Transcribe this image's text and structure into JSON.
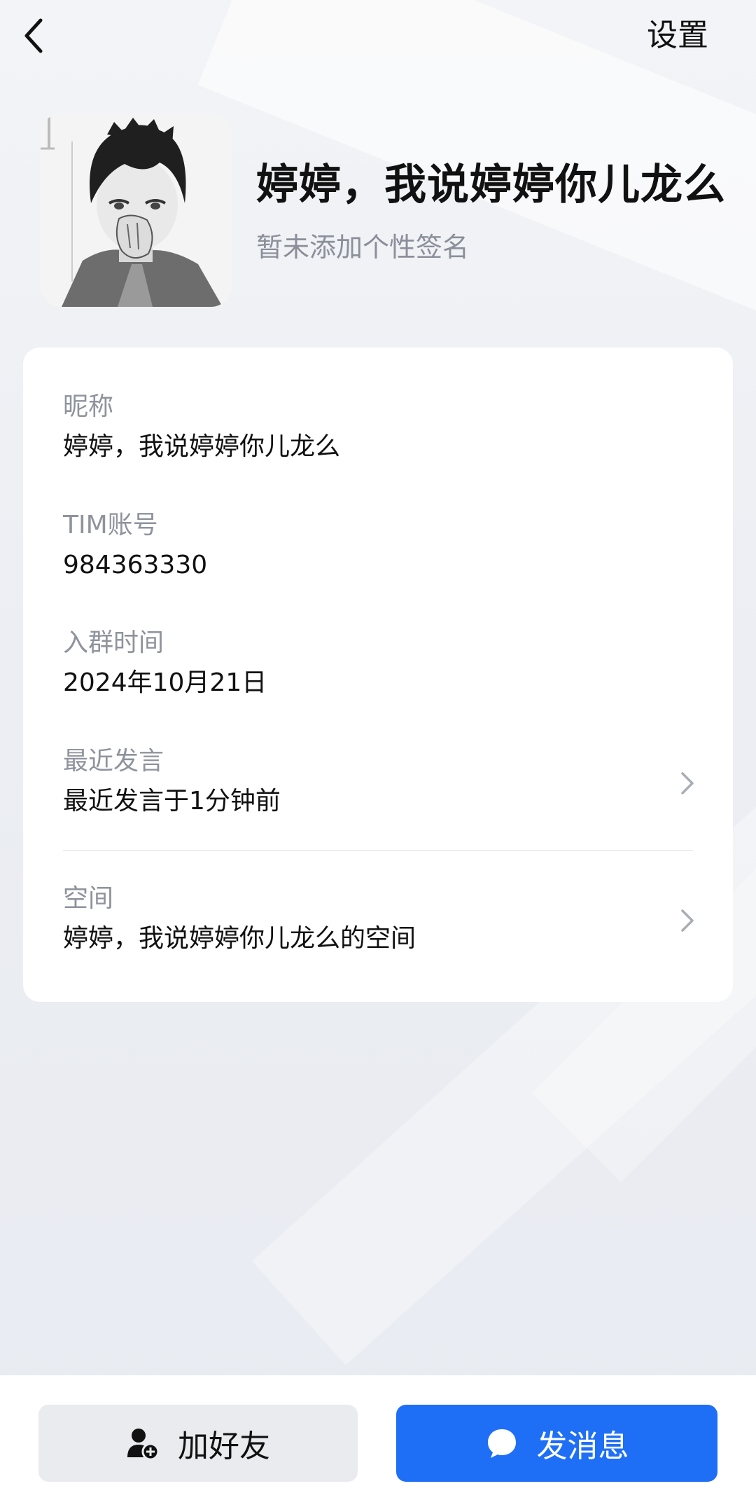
{
  "header": {
    "back_icon": "chevron-left-icon",
    "settings_label": "设置"
  },
  "profile": {
    "display_name": "婷婷，我说婷婷你儿龙么",
    "signature": "暂未添加个性签名",
    "avatar_description": "manga avatar"
  },
  "info": {
    "nickname": {
      "label": "昵称",
      "value": "婷婷，我说婷婷你儿龙么"
    },
    "account": {
      "label": "TIM账号",
      "value": "984363330"
    },
    "join_time": {
      "label": "入群时间",
      "value": "2024年10月21日"
    },
    "recent_speech": {
      "label": "最近发言",
      "value": "最近发言于1分钟前"
    },
    "space": {
      "label": "空间",
      "value": "婷婷，我说婷婷你儿龙么的空间"
    }
  },
  "actions": {
    "add_friend_label": "加好友",
    "add_friend_icon": "add-user-icon",
    "send_message_label": "发消息",
    "send_message_icon": "chat-bubble-icon"
  },
  "colors": {
    "accent": "#1f6ff6",
    "label_gray": "#8e939c",
    "secondary_button": "#eaebee"
  }
}
